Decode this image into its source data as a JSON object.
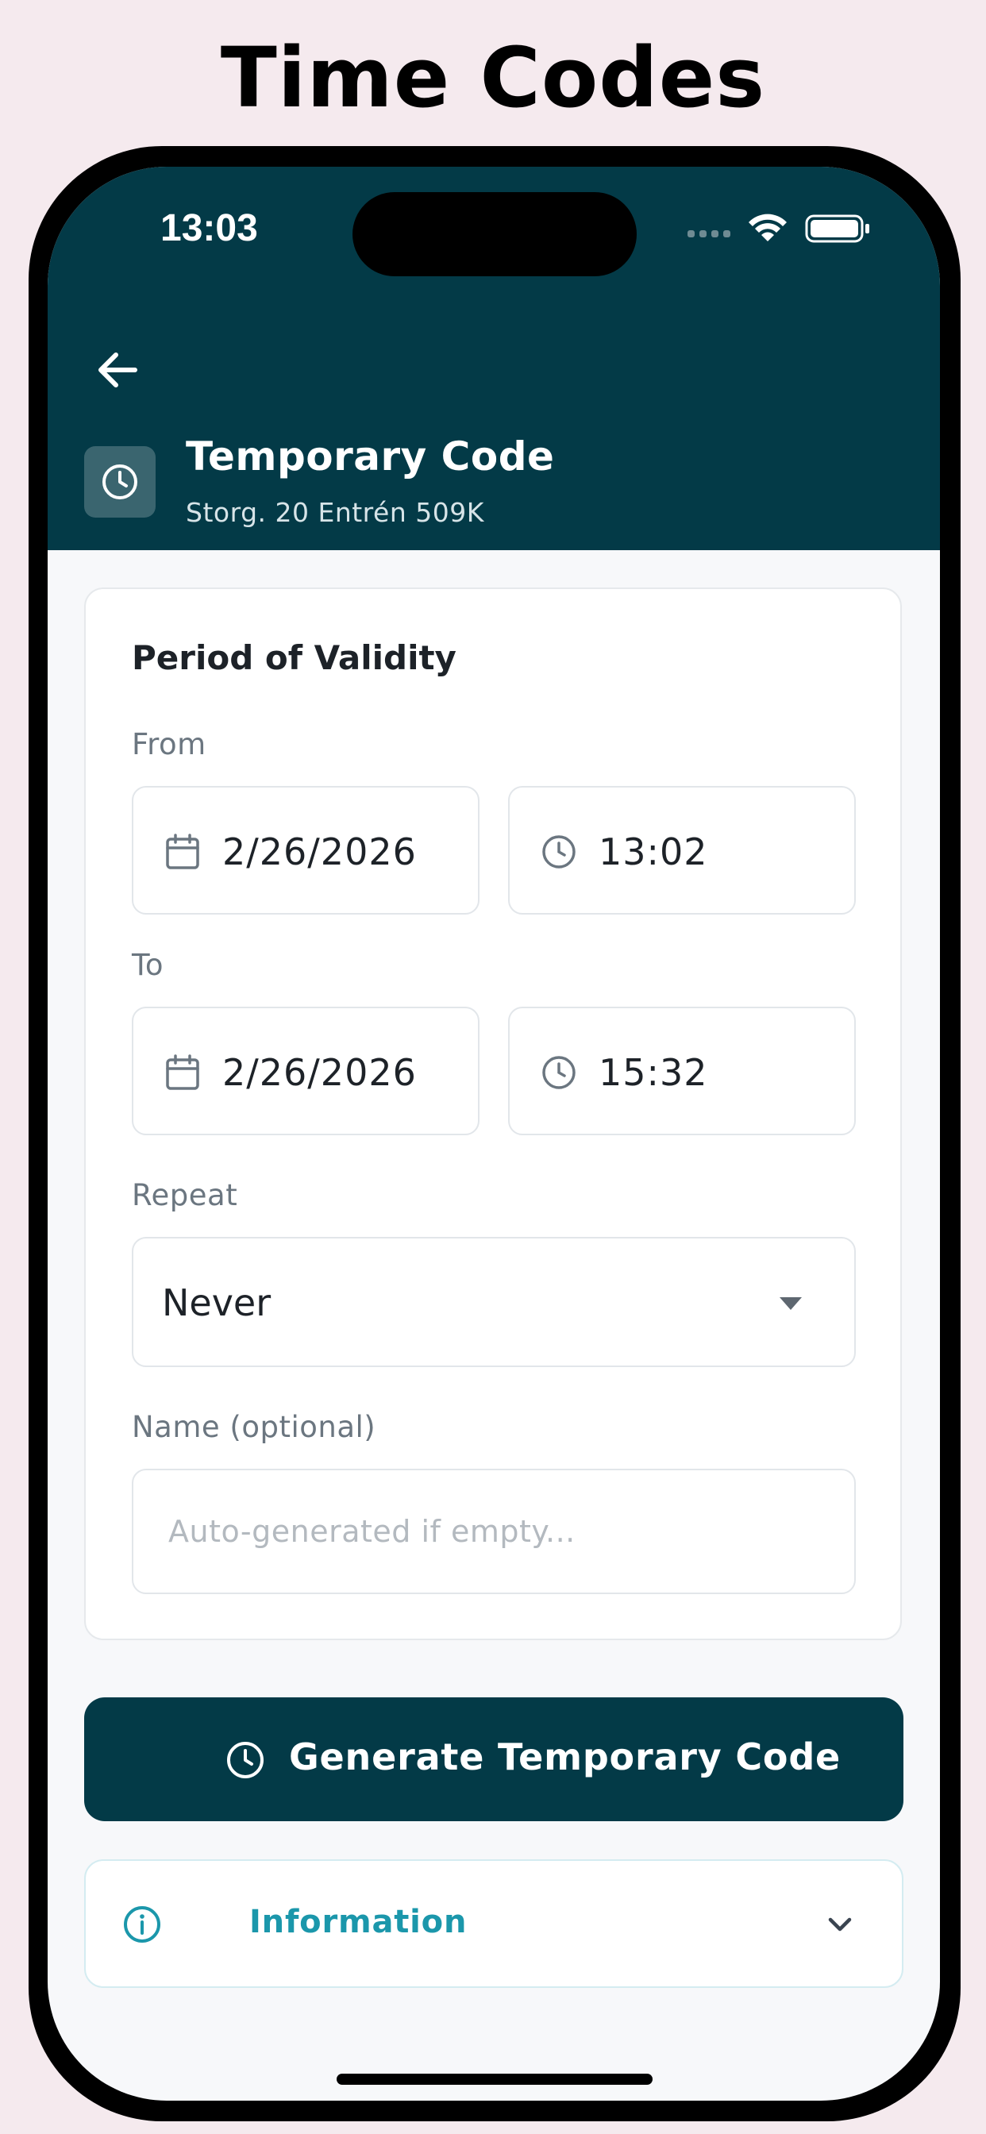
{
  "page_heading": "Time Codes",
  "status_bar": {
    "time": "13:03"
  },
  "header": {
    "title": "Temporary Code",
    "subtitle": "Storg. 20 Entrén 509K"
  },
  "form": {
    "section_title": "Period of Validity",
    "from_label": "From",
    "from_date": "2/26/2026",
    "from_time": "13:02",
    "to_label": "To",
    "to_date": "2/26/2026",
    "to_time": "15:32",
    "repeat_label": "Repeat",
    "repeat_value": "Never",
    "name_label": "Name (optional)",
    "name_placeholder": "Auto-generated if empty..."
  },
  "generate_button": {
    "label": "Generate Temporary Code"
  },
  "info_panel": {
    "label": "Information"
  },
  "colors": {
    "primary": "#033a47",
    "accent": "#1b97ab",
    "background": "#f5eaee"
  },
  "icons": [
    "back-arrow-icon",
    "clock-icon",
    "calendar-icon",
    "info-icon",
    "chevron-down-icon",
    "wifi-icon",
    "battery-icon",
    "cellular-signal-icon"
  ]
}
